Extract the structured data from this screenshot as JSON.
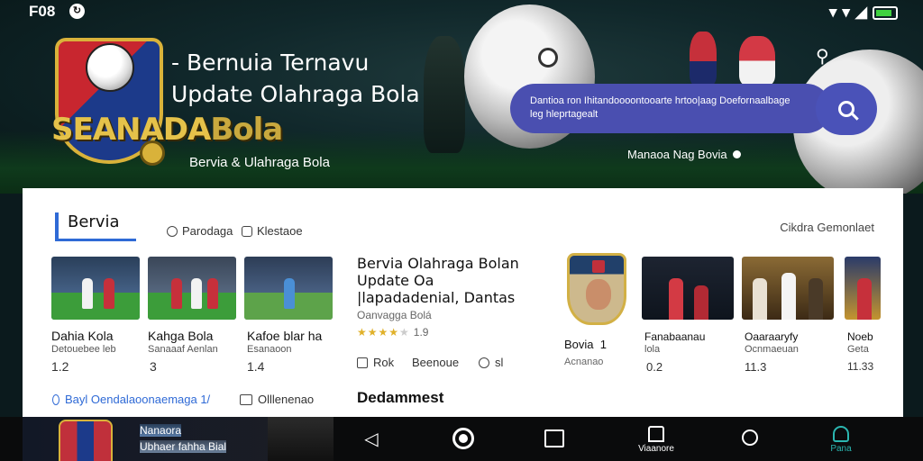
{
  "status_bar": {
    "time": "F08",
    "sync_icon": "sync-icon",
    "icons": [
      "wifi-icon",
      "wifi-icon",
      "signal-icon",
      "battery-icon"
    ]
  },
  "hero": {
    "logo_text": "SEANADA",
    "logo_text_accent": "Bola",
    "title": "- Bernuia Ternavu",
    "subtitle": "Update Olahraga Bola",
    "tagline": "Bervia & Ulahraga Bola",
    "search_text": "Dantioa ron Ihitandoooontooarte hrtoo|aag Doefornaalbage leg hleprtagealt",
    "link": "Manaoa Nag Bovia"
  },
  "section": {
    "title": "Bervia",
    "tabs": [
      {
        "label": "Parodaga",
        "icon": "circle-icon"
      },
      {
        "label": "Klestaoe",
        "icon": "square-icon"
      }
    ],
    "right_label": "Cikdra Gemonlaet"
  },
  "news_items": [
    {
      "title": "Dahia Kola",
      "subtitle": "Detouebee leb",
      "value": "1.2"
    },
    {
      "title": "Kahga Bola",
      "subtitle": "Sanaaaf Aenlan",
      "value": "3"
    },
    {
      "title": "Kafoe blar ha",
      "subtitle": "Esanaoon",
      "value": "1.4"
    }
  ],
  "featured": {
    "title": "Bervia Olahraga Bolan Update Oa |lapadadenial, Dantas",
    "source": "Oanvagga Bolá",
    "rating": "1.9",
    "rating_stars": 4,
    "meta": [
      {
        "label": "Rok",
        "icon": "calendar-icon"
      },
      {
        "label": "Beenoue",
        "icon": ""
      },
      {
        "label": "sl",
        "icon": "chat-icon"
      }
    ]
  },
  "club": {
    "name": "Bovia",
    "number": "1",
    "subtitle": "Acnanao"
  },
  "photo_items": [
    {
      "title": "Fanabaanau",
      "subtitle": "lola",
      "value": "0.2"
    },
    {
      "title": "Oaaraaryfy",
      "subtitle": "Ocnmaeuan",
      "value": "11.3"
    },
    {
      "title": "Noeb",
      "subtitle": "Geta",
      "value": "11.33"
    }
  ],
  "bottom_links": {
    "primary": "Bayl Oendalaoonaemaga 1/",
    "secondary": "Olllenenao"
  },
  "section2": {
    "title": "Dedammest"
  },
  "promo": {
    "line1": "Nanaora",
    "line2": "Ubhaer fahha Bial"
  },
  "nav": {
    "tabs": [
      {
        "label": "Viaanore",
        "icon": "home-icon"
      },
      {
        "label": "",
        "icon": "circle-icon"
      },
      {
        "label": "Pana",
        "icon": "profile-icon"
      }
    ]
  },
  "colors": {
    "accent": "#2f6ad6",
    "search_pill": "#4a4fb0",
    "profile_active": "#2bb6b0",
    "logo_gold": "#d9b23a"
  }
}
